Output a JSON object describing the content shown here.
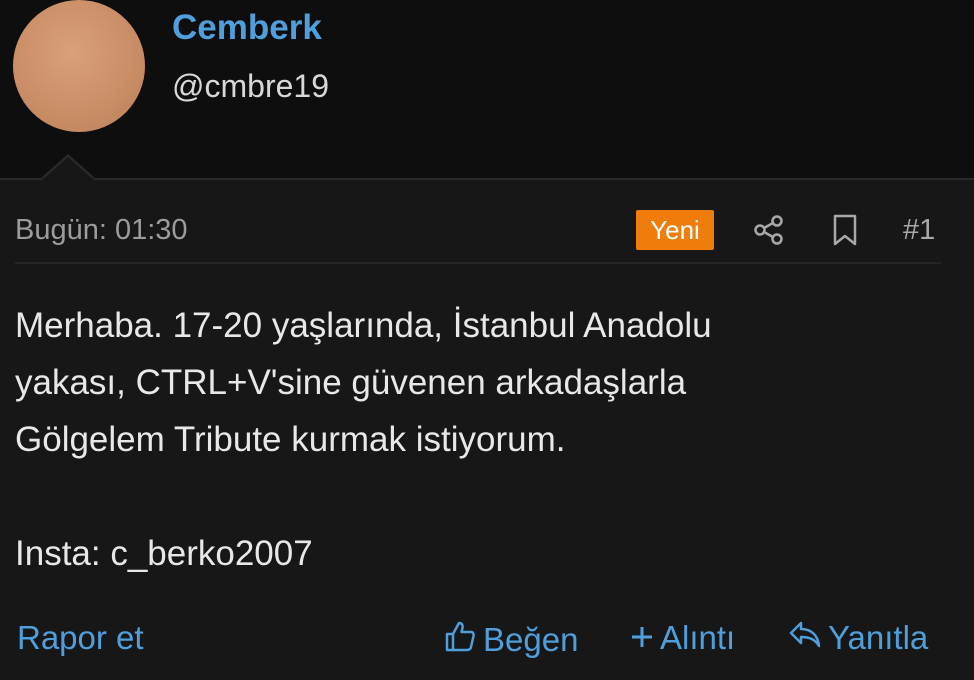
{
  "profile": {
    "name": "Cemberk",
    "handle": "@cmbre19"
  },
  "post": {
    "date": "Bugün: 01:30",
    "badge": "Yeni",
    "number": "#1",
    "lines": [
      "Merhaba. 17-20 yaşlarında, İstanbul Anadolu",
      "yakası, CTRL+V'sine güvenen arkadaşlarla",
      "Gölgelem Tribute kurmak istiyorum."
    ],
    "insta": "Insta: c_berko2007"
  },
  "actions": {
    "report": "Rapor et",
    "like": "Beğen",
    "quote": "Alıntı",
    "reply": "Yanıtla"
  },
  "icons": {
    "share": "share-icon",
    "bookmark": "bookmark-icon",
    "like": "thumbs-up-icon",
    "quote": "plus-icon",
    "reply": "reply-icon"
  },
  "colors": {
    "accent": "#4f9fdc",
    "badge": "#f07c0c",
    "background": "#171717"
  }
}
